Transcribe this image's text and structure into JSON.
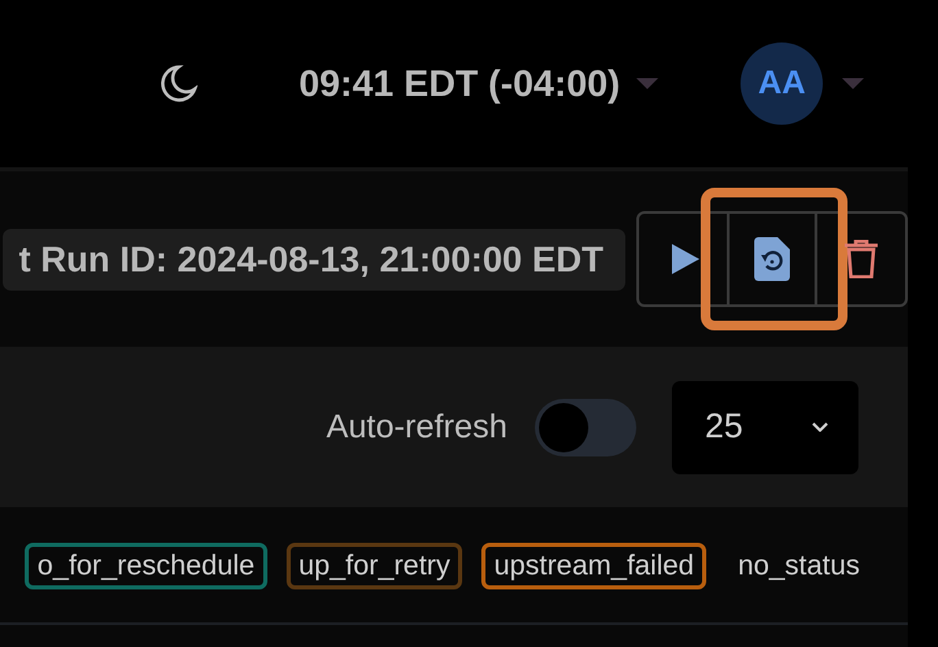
{
  "header": {
    "clock": "09:41 EDT (-04:00)",
    "avatar": "AA"
  },
  "run": {
    "run_id": "t Run ID: 2024-08-13, 21:00:00 EDT",
    "actions": [
      {
        "kind": "play",
        "highlighted": false
      },
      {
        "kind": "clear",
        "highlighted": true
      },
      {
        "kind": "delete",
        "highlighted": false
      }
    ]
  },
  "controls": {
    "auto_refresh": {
      "label": "Auto-refresh",
      "on": false
    },
    "page_size": "25"
  },
  "states": [
    {
      "label": "o_for_reschedule",
      "color": "#0f6b60"
    },
    {
      "label": "up_for_retry",
      "color": "#5a3711"
    },
    {
      "label": "upstream_failed",
      "color": "#b85e0e"
    },
    {
      "label": "no_status"
    }
  ]
}
